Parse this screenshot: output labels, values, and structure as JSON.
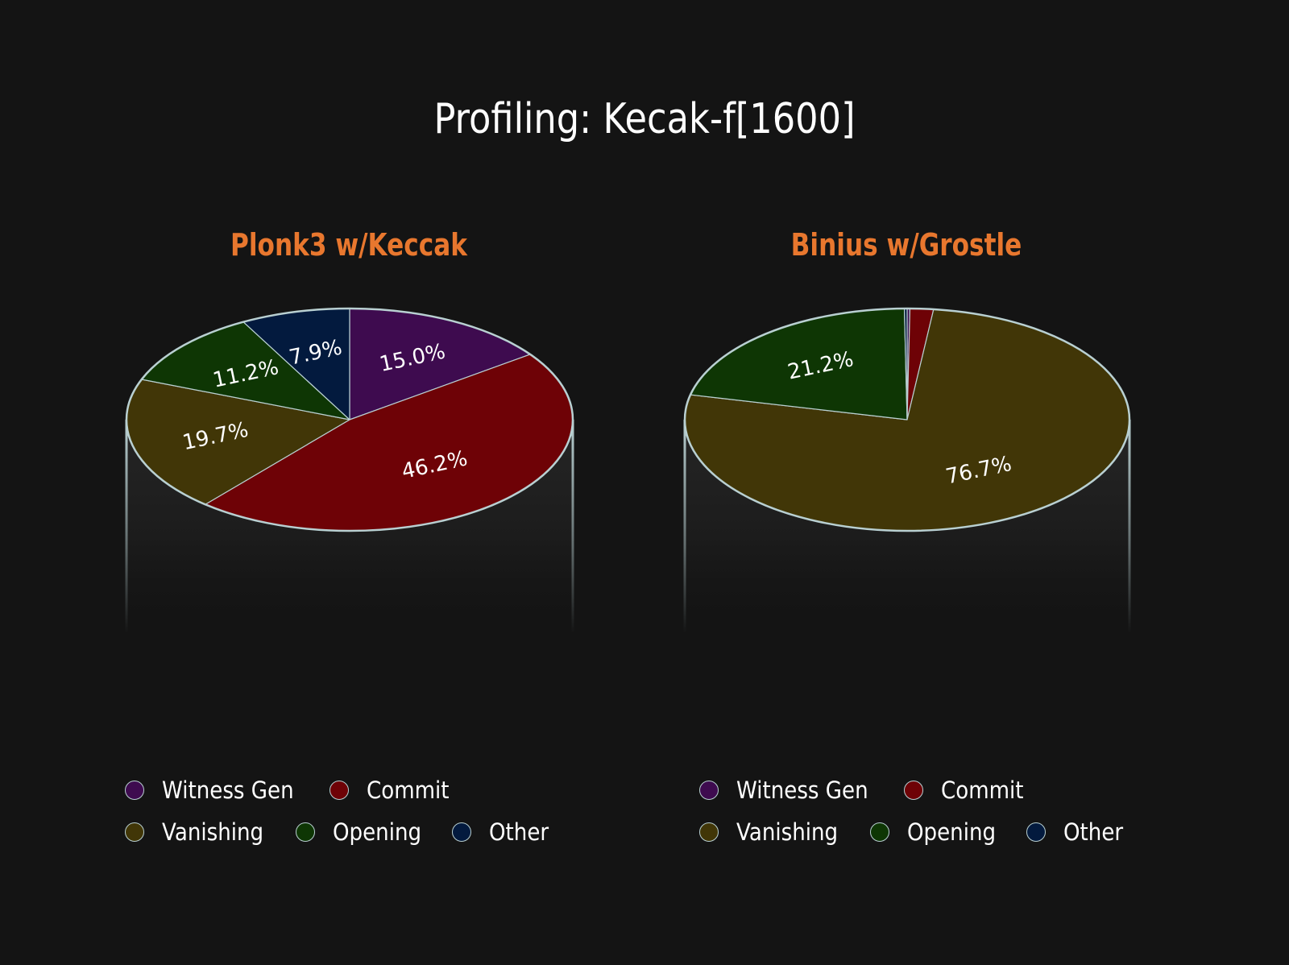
{
  "title": "Profiling: Kecak-f[1600]",
  "colors": {
    "background": "#141414",
    "outline": "#b9d0d2",
    "accent": "#e8772e",
    "Witness Gen": "#3e0b4f",
    "Commit": "#6e0206",
    "Vanishing": "#413607",
    "Opening": "#0e3604",
    "Other": "#031a3e"
  },
  "chart_data": [
    {
      "type": "pie",
      "title": "Plonk3 w/Keccak",
      "categories": [
        "Witness Gen",
        "Commit",
        "Vanishing",
        "Opening",
        "Other"
      ],
      "values": [
        15.0,
        46.2,
        19.7,
        11.2,
        7.9
      ],
      "labels": [
        "15.0%",
        "46.2%",
        "19.7%",
        "11.2%",
        "7.9%"
      ],
      "start_angle": "top",
      "direction": "clockwise",
      "legend": {
        "placement": "bottom",
        "rows": [
          [
            "Witness Gen",
            "Commit"
          ],
          [
            "Vanishing",
            "Opening",
            "Other"
          ]
        ]
      }
    },
    {
      "type": "pie",
      "title": "Binius w/Grostle",
      "categories": [
        "Witness Gen",
        "Commit",
        "Vanishing",
        "Opening",
        "Other"
      ],
      "values": [
        0.2,
        1.7,
        76.7,
        21.2,
        0.2
      ],
      "labels": [
        "",
        "",
        "76.7%",
        "21.2%",
        ""
      ],
      "start_angle": "top",
      "direction": "clockwise",
      "legend": {
        "placement": "bottom",
        "rows": [
          [
            "Witness Gen",
            "Commit"
          ],
          [
            "Vanishing",
            "Opening",
            "Other"
          ]
        ]
      }
    }
  ]
}
